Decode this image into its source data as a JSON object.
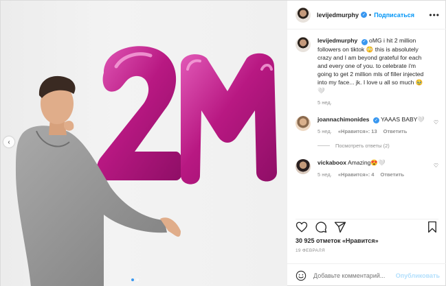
{
  "header": {
    "username": "levijedmurphy",
    "follow_label": "Подписаться",
    "separator": "•"
  },
  "caption": {
    "username": "levijedmurphy",
    "text": "oMG i hit 2 million followers on tiktok 😳 this is absolutely crazy and I am beyond grateful for each and every one of you. to celebrate i'm going to get 2 million mls of filler injected into my face... jk. I love u all so much 🥹🤍",
    "time": "5 нед."
  },
  "comments": [
    {
      "username": "joannachimonides",
      "text": "YAAAS BABY🤍",
      "time": "5 нед.",
      "likes": "«Нравится»: 13",
      "reply_label": "Ответить",
      "view_replies": "Посмотреть ответы (2)"
    },
    {
      "username": "vickaboox",
      "text": "Amazing😍🤍",
      "time": "5 нед.",
      "likes": "«Нравится»: 4",
      "reply_label": "Ответить"
    }
  ],
  "stats": {
    "likes": "30 925 отметок «Нравится»",
    "date": "19 ФЕВРАЛЯ"
  },
  "add_comment": {
    "placeholder": "Добавьте комментарий...",
    "post_label": "Опубликовать"
  },
  "photo": {
    "balloon_text": "2M",
    "balloon_color": "#c2208a"
  },
  "colors": {
    "accent": "#0095f6",
    "verified": "#3897f0"
  },
  "icons": [
    "heart-icon",
    "comment-icon",
    "share-icon",
    "bookmark-icon",
    "emoji-icon",
    "more-icon",
    "verified-icon",
    "prev-arrow-icon"
  ]
}
